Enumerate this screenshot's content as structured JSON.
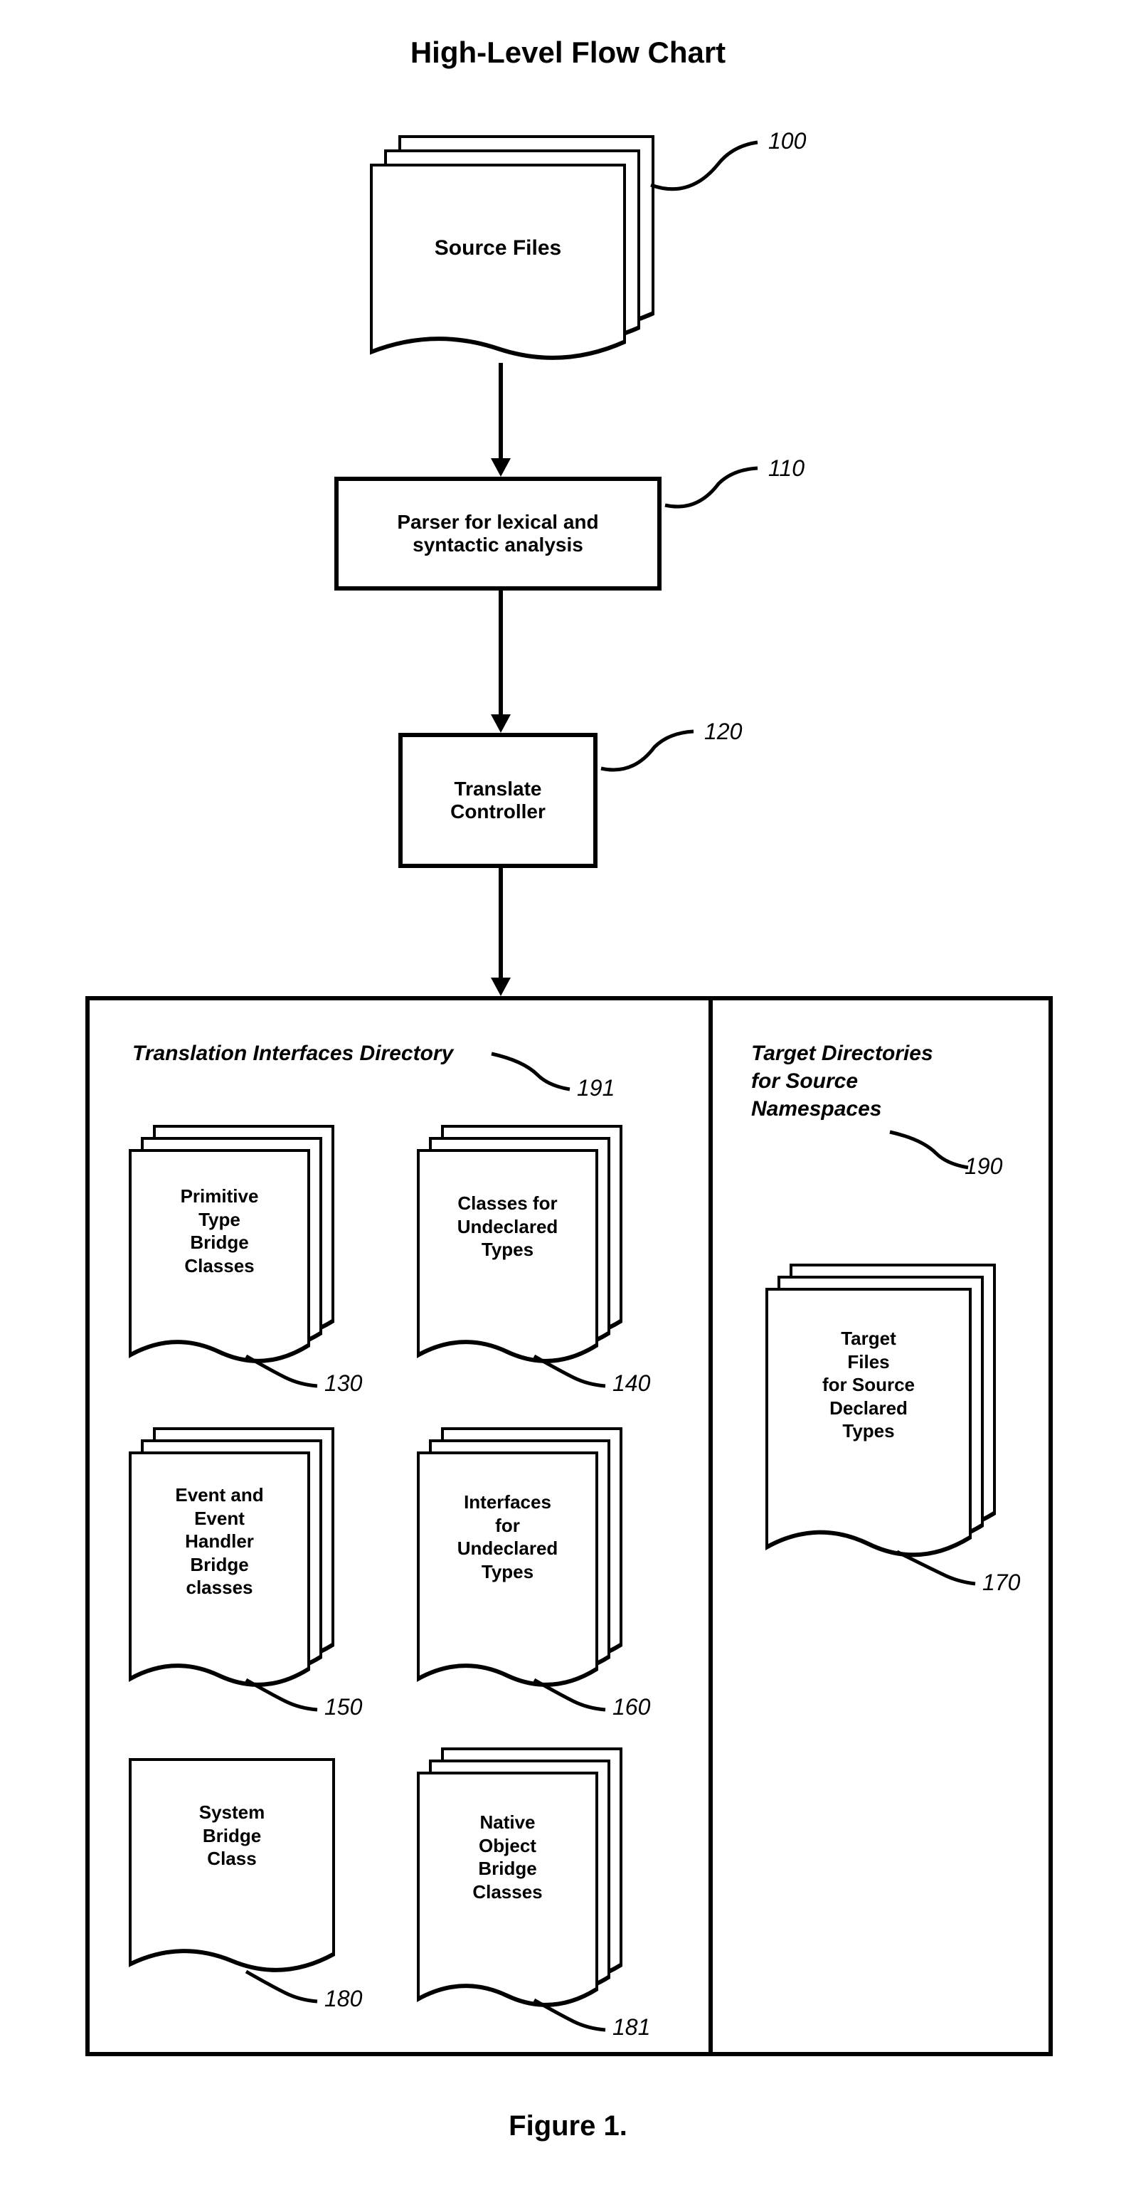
{
  "title": "High-Level Flow Chart",
  "figure_label": "Figure 1.",
  "nodes": {
    "source_files": {
      "label": "Source Files",
      "ref": "100"
    },
    "parser": {
      "label": "Parser for lexical and\nsyntactic analysis",
      "ref": "110"
    },
    "translate_controller": {
      "label": "Translate\nController",
      "ref": "120"
    }
  },
  "sections": {
    "translation_interfaces": {
      "label": "Translation Interfaces Directory",
      "ref": "191"
    },
    "target_directories": {
      "label": "Target  Directories\nfor Source\nNamespaces",
      "ref": "190"
    }
  },
  "outputs": {
    "primitive": {
      "label": "Primitive\nType\nBridge\nClasses",
      "ref": "130"
    },
    "classes_undeclared": {
      "label": "Classes for\nUndeclared\nTypes",
      "ref": "140"
    },
    "event_handler": {
      "label": "Event and\nEvent\nHandler\nBridge\nclasses",
      "ref": "150"
    },
    "interfaces_undeclared": {
      "label": "Interfaces\nfor\nUndeclared\nTypes",
      "ref": "160"
    },
    "system_bridge": {
      "label": "System\nBridge\nClass",
      "ref": "180"
    },
    "native_object": {
      "label": "Native\nObject\nBridge\nClasses",
      "ref": "181"
    },
    "target_files": {
      "label": "Target\nFiles\nfor Source\nDeclared\nTypes",
      "ref": "170"
    }
  }
}
